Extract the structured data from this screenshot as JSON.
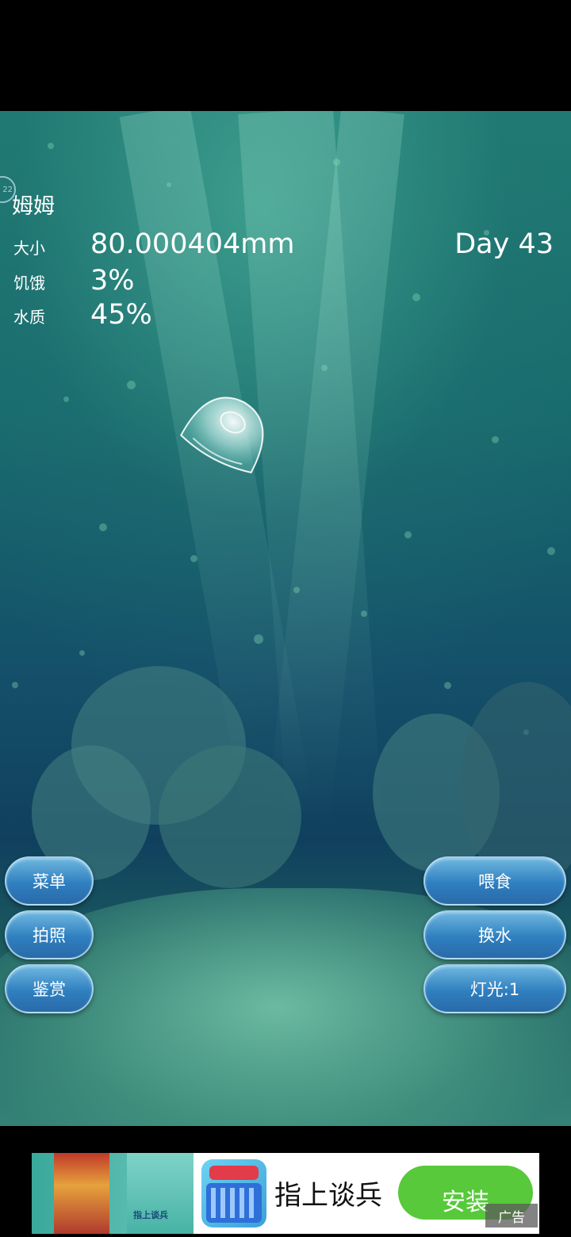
{
  "pet": {
    "name": "姆姆",
    "badge": "22"
  },
  "stats": [
    {
      "label": "大小",
      "value": "80.000404mm"
    },
    {
      "label": "饥饿",
      "value": "3%"
    },
    {
      "label": "水质",
      "value": "45%"
    }
  ],
  "day": "Day 43",
  "left_buttons": {
    "menu": "菜单",
    "photo": "拍照",
    "appreciate": "鉴赏"
  },
  "right_buttons": {
    "feed": "喂食",
    "water": "换水",
    "light": "灯光:1"
  },
  "ad": {
    "title": "指上谈兵",
    "install": "安装",
    "tag": "广告",
    "caption": "指上谈兵"
  },
  "colors": {
    "button_blue": "#2f7fc0",
    "install_green": "#57c93a",
    "water": "#176a6c"
  }
}
